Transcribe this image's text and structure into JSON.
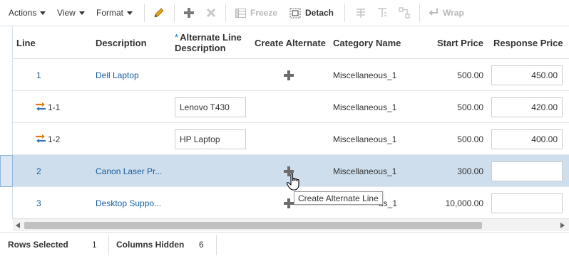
{
  "toolbar": {
    "actions": "Actions",
    "view": "View",
    "format": "Format",
    "freeze": "Freeze",
    "detach": "Detach",
    "wrap": "Wrap"
  },
  "columns": {
    "line": "Line",
    "description": "Description",
    "alt_required": "*",
    "alt_line_1": "Alternate Line",
    "alt_line_2": "Description",
    "create_alternate": "Create Alternate",
    "category": "Category Name",
    "start_price": "Start Price",
    "response_price": "Response Price"
  },
  "rows": [
    {
      "line": "1",
      "description": "Dell Laptop",
      "alt_desc": "",
      "category": "Miscellaneous_1",
      "start_price": "500.00",
      "response_price": "450.00"
    },
    {
      "line": "1-1",
      "description": "",
      "alt_desc": "Lenovo T430",
      "category": "Miscellaneous_1",
      "start_price": "500.00",
      "response_price": "420.00"
    },
    {
      "line": "1-2",
      "description": "",
      "alt_desc": "HP Laptop",
      "category": "Miscellaneous_1",
      "start_price": "500.00",
      "response_price": "400.00"
    },
    {
      "line": "2",
      "description": "Canon Laser Pr...",
      "alt_desc": "",
      "category": "Miscellaneous_1",
      "start_price": "300.00",
      "response_price": ""
    },
    {
      "line": "3",
      "description": "Desktop Suppo...",
      "alt_desc": "",
      "category": "us_1",
      "start_price": "10,000.00",
      "response_price": ""
    }
  ],
  "tooltip": "Create Alternate Line",
  "status": {
    "rows_selected_label": "Rows Selected",
    "rows_selected_value": "1",
    "columns_hidden_label": "Columns Hidden",
    "columns_hidden_value": "6"
  },
  "colors": {
    "link": "#145c9e",
    "selected_row": "#cfdeed",
    "required_star": "#0572ce"
  }
}
